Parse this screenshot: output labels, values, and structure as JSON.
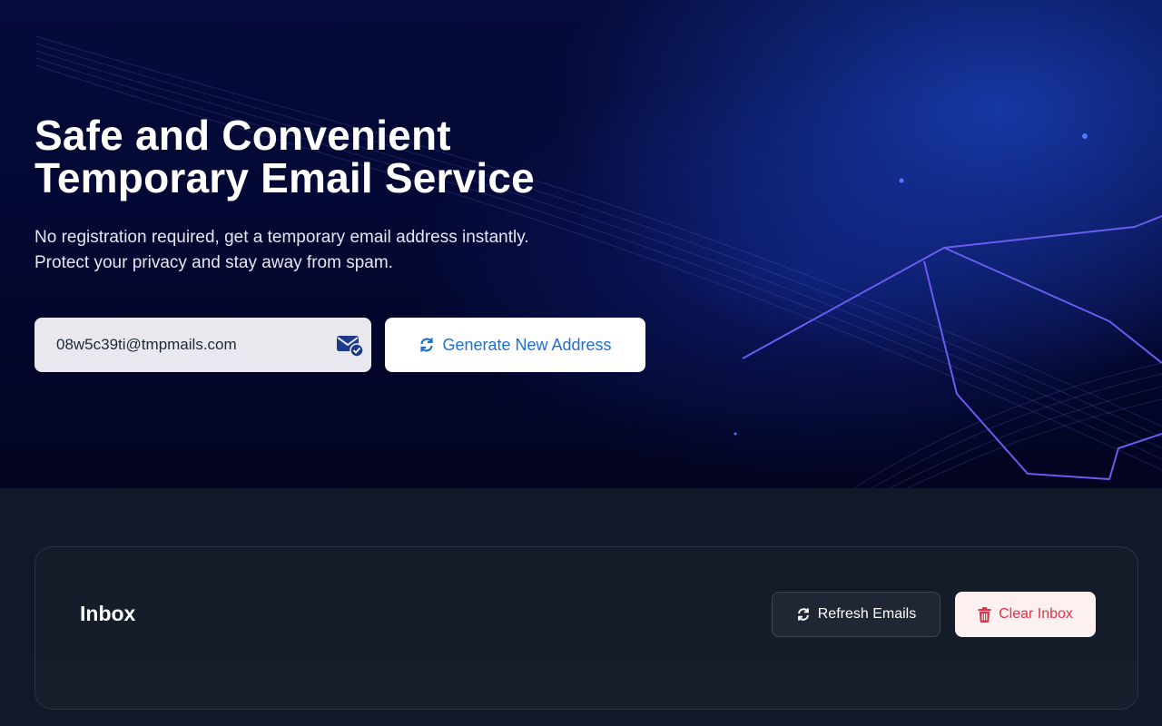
{
  "hero": {
    "title_line1": "Safe and Convenient",
    "title_line2": "Temporary Email Service",
    "subtitle_line1": "No registration required, get a temporary email address instantly.",
    "subtitle_line2": "Protect your privacy and stay away from spam."
  },
  "email": {
    "address": "08w5c39ti@tmpmails.com",
    "icon": "mail-check-icon"
  },
  "actions": {
    "generate_label": "Generate New Address",
    "generate_icon": "refresh-icon"
  },
  "inbox": {
    "title": "Inbox",
    "refresh_label": "Refresh Emails",
    "refresh_icon": "refresh-icon",
    "clear_label": "Clear Inbox",
    "clear_icon": "trash-icon"
  },
  "colors": {
    "accent_blue": "#1d6fd1",
    "danger_red": "#dc3545",
    "hero_bg": "#040833",
    "page_bg": "#111827"
  }
}
